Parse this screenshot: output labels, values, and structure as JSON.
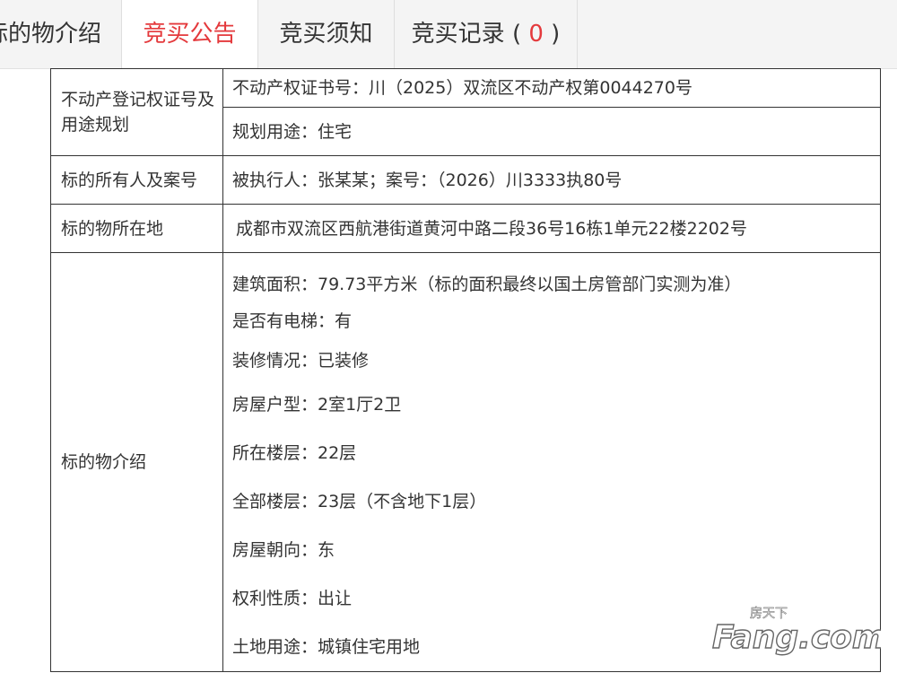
{
  "tabs": {
    "intro": "标的物介绍",
    "announcement": "竞买公告",
    "notice": "竞买须知",
    "records_label": "竞买记录",
    "records_open": "(",
    "records_count": "0",
    "records_close": ")"
  },
  "table": {
    "row1": {
      "label": "不动产登记权证号及用途规划",
      "cert": "不动产权证书号：川（2025）双流区不动产权第0044270号",
      "usage": "规划用途：住宅"
    },
    "row2": {
      "label": "标的所有人及案号",
      "value": "被执行人：张某某；案号：（2026）川3333执80号"
    },
    "row3": {
      "label": "标的物所在地",
      "value": "成都市双流区西航港街道黄河中路二段36号16栋1单元22楼2202号"
    },
    "row4": {
      "label": "标的物介绍",
      "items": [
        "建筑面积：79.73平方米（标的面积最终以国土房管部门实测为准）",
        "是否有电梯：有",
        "装修情况：已装修",
        "房屋户型：2室1厅2卫",
        "所在楼层：22层",
        "全部楼层：23层（不含地下1层）",
        "房屋朝向：东",
        "权利性质：出让",
        "土地用途：城镇住宅用地"
      ]
    }
  },
  "watermark": {
    "top": "房天下",
    "brand": "Fang.com"
  },
  "colors": {
    "accent": "#e4393c",
    "tab_bg": "#f4f4f4",
    "border": "#333333"
  }
}
